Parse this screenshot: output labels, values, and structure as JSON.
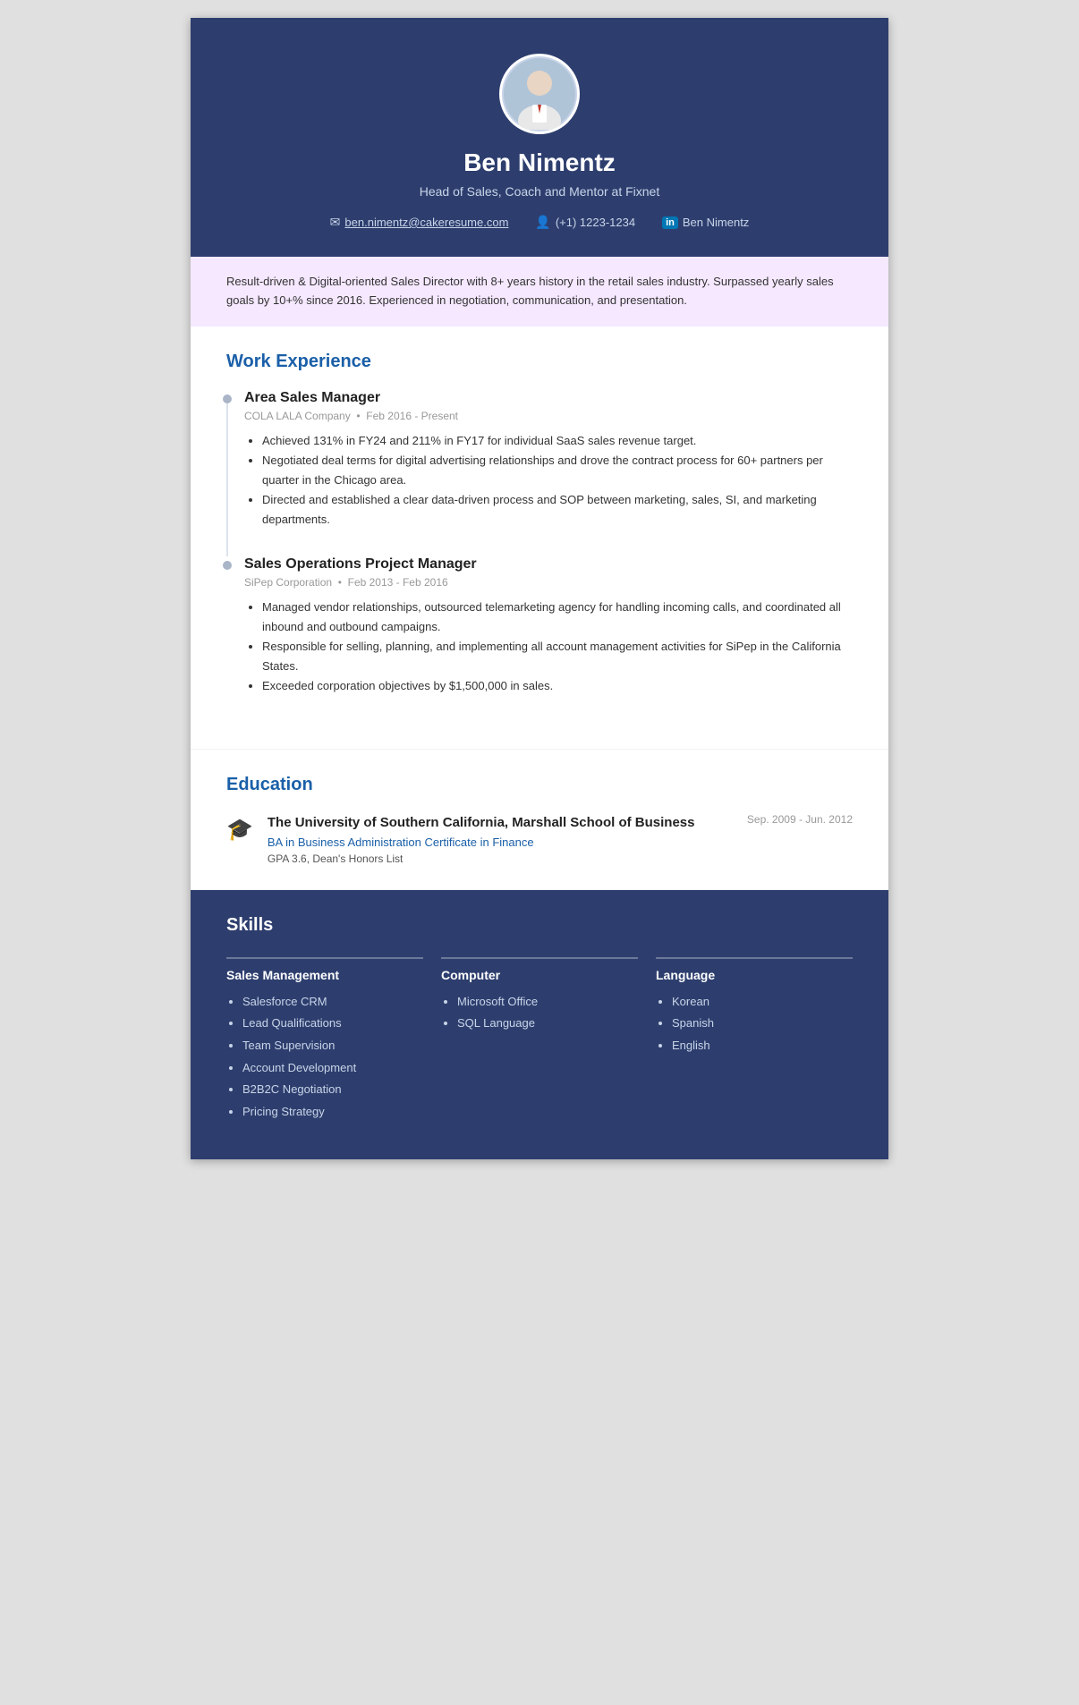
{
  "header": {
    "name": "Ben Nimentz",
    "title": "Head of Sales, Coach and Mentor at Fixnet",
    "email": "ben.nimentz@cakeresume.com",
    "phone": "(+1) 1223-1234",
    "linkedin": "Ben Nimentz"
  },
  "summary": {
    "text": "Result-driven & Digital-oriented Sales Director with 8+ years history in the retail sales industry. Surpassed yearly sales goals by 10+% since 2016. Experienced in negotiation, communication, and presentation."
  },
  "work_experience": {
    "section_title": "Work Experience",
    "jobs": [
      {
        "title": "Area Sales Manager",
        "company": "COLA LALA Company",
        "period": "Feb 2016 - Present",
        "bullets": [
          "Achieved 131% in FY24 and 211% in FY17 for individual SaaS sales revenue target.",
          "Negotiated deal terms for digital advertising relationships and drove the contract process for 60+ partners per quarter in the Chicago area.",
          "Directed and established a clear data-driven process and SOP between marketing, sales, SI, and marketing departments."
        ]
      },
      {
        "title": "Sales Operations Project Manager",
        "company": "SiPep Corporation",
        "period": "Feb 2013 - Feb 2016",
        "bullets": [
          "Managed vendor relationships, outsourced telemarketing agency for handling incoming calls, and coordinated all inbound and outbound campaigns.",
          "Responsible for selling, planning, and implementing all account management activities for SiPep in the California States.",
          "Exceeded corporation objectives by $1,500,000 in sales."
        ]
      }
    ]
  },
  "education": {
    "section_title": "Education",
    "items": [
      {
        "school": "The University of Southern California, Marshall School of Business",
        "degree": "BA in Business Administration Certificate in Finance",
        "gpa": "GPA 3.6, Dean's Honors List",
        "dates": "Sep. 2009 - Jun. 2012"
      }
    ]
  },
  "skills": {
    "section_title": "Skills",
    "categories": [
      {
        "title": "Sales Management",
        "items": [
          "Salesforce CRM",
          "Lead Qualifications",
          "Team Supervision",
          "Account Development",
          "B2B2C Negotiation",
          "Pricing Strategy"
        ]
      },
      {
        "title": "Computer",
        "items": [
          "Microsoft Office",
          "SQL Language"
        ]
      },
      {
        "title": "Language",
        "items": [
          "Korean",
          "Spanish",
          "English"
        ]
      }
    ]
  }
}
